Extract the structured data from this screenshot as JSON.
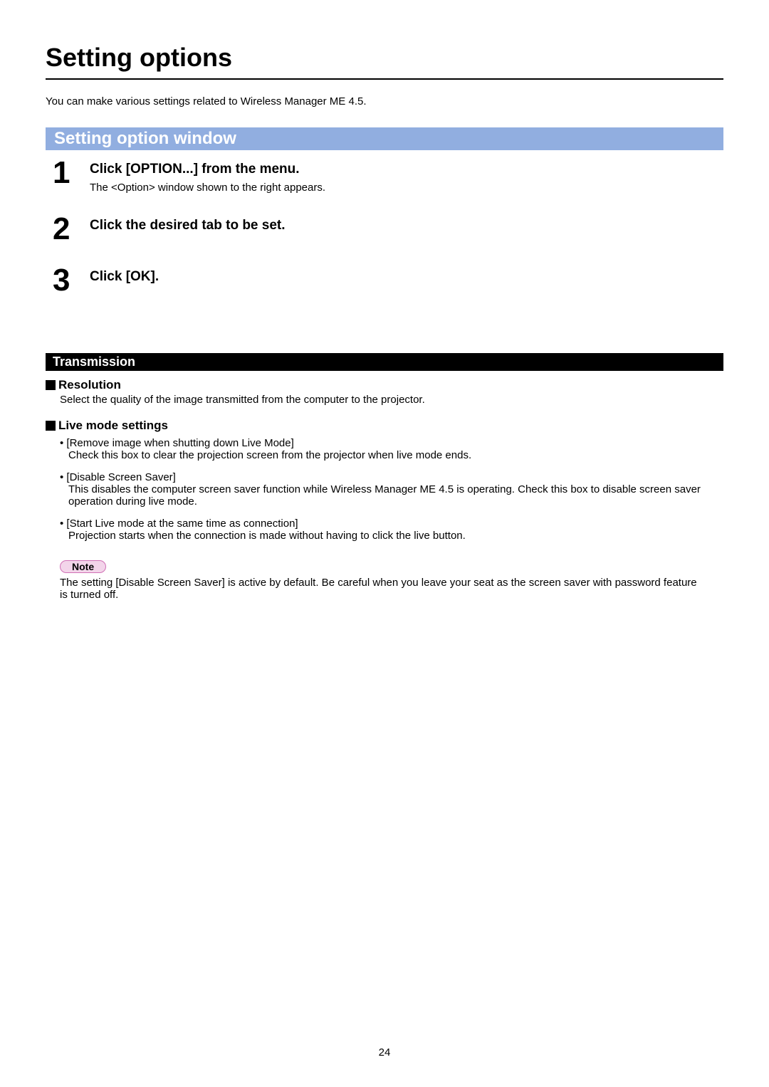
{
  "title": "Setting options",
  "intro": "You can make various settings related to Wireless Manager ME 4.5.",
  "settingOptionWindow": {
    "header": "Setting option window",
    "steps": [
      {
        "num": "1",
        "heading": "Click [OPTION...] from the menu.",
        "desc": "The <Option> window shown to the right appears."
      },
      {
        "num": "2",
        "heading": "Click the desired tab to be set.",
        "desc": ""
      },
      {
        "num": "3",
        "heading": "Click [OK].",
        "desc": ""
      }
    ]
  },
  "transmission": {
    "header": "Transmission",
    "resolution": {
      "title": "Resolution",
      "desc": "Select the quality of the image transmitted from the computer to the projector."
    },
    "liveMode": {
      "title": "Live mode settings",
      "items": [
        {
          "label": "[Remove image when shutting down Live Mode]",
          "body": "Check this box to clear the projection screen from the projector when live mode ends."
        },
        {
          "label": "[Disable Screen Saver]",
          "body": "This disables the computer screen saver function while Wireless Manager ME 4.5 is operating. Check this box to disable screen saver operation during live mode."
        },
        {
          "label": "[Start Live mode at the same time as connection]",
          "body": "Projection starts when the connection is made without having to click the live button."
        }
      ]
    },
    "note": {
      "badge": "Note",
      "text": "The setting [Disable Screen Saver] is active by default. Be careful when you leave your seat as the screen saver with password feature is turned off."
    }
  },
  "pageNumber": "24"
}
